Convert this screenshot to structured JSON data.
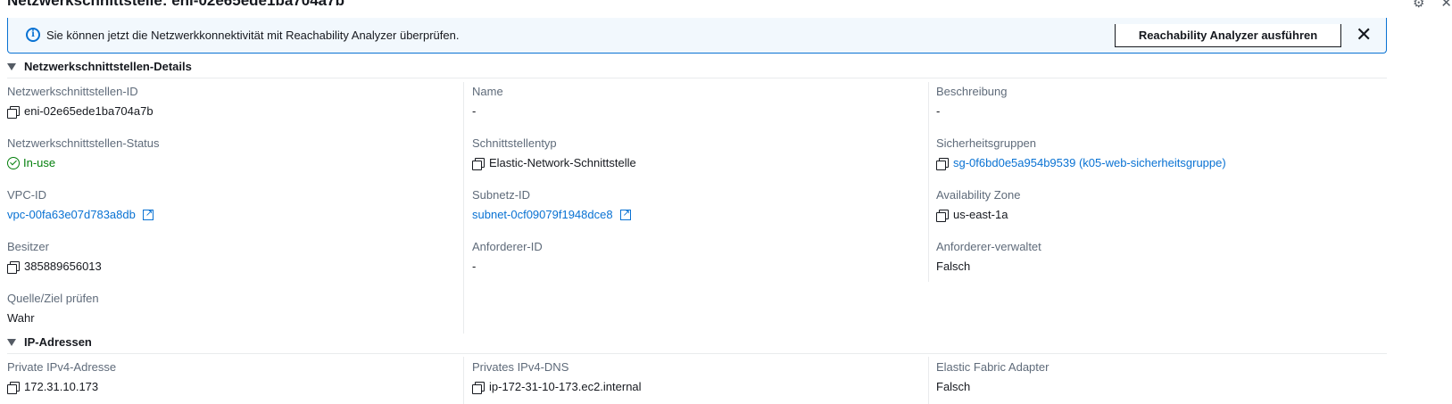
{
  "panel": {
    "title": "Netzwerkschnittstelle: eni-02e65ede1ba704a7b"
  },
  "banner": {
    "message": "Sie können jetzt die Netzwerkkonnektivität mit Reachability Analyzer überprüfen.",
    "button_label": "Reachability Analyzer ausführen"
  },
  "details": {
    "title": "Netzwerkschnittstellen-Details",
    "eni_id": {
      "label": "Netzwerkschnittstellen-ID",
      "value": "eni-02e65ede1ba704a7b"
    },
    "name": {
      "label": "Name",
      "value": "-"
    },
    "description": {
      "label": "Beschreibung",
      "value": "-"
    },
    "status": {
      "label": "Netzwerkschnittstellen-Status",
      "value": "In-use"
    },
    "interface_type": {
      "label": "Schnittstellentyp",
      "value": "Elastic-Network-Schnittstelle"
    },
    "security_groups": {
      "label": "Sicherheitsgruppen",
      "value": "sg-0f6bd0e5a954b9539 (k05-web-sicherheitsgruppe)"
    },
    "vpc_id": {
      "label": "VPC-ID",
      "value": "vpc-00fa63e07d783a8db"
    },
    "subnet_id": {
      "label": "Subnetz-ID",
      "value": "subnet-0cf09079f1948dce8"
    },
    "availability_zone": {
      "label": "Availability Zone",
      "value": "us-east-1a"
    },
    "owner": {
      "label": "Besitzer",
      "value": "385889656013"
    },
    "requester_id": {
      "label": "Anforderer-ID",
      "value": "-"
    },
    "requester_managed": {
      "label": "Anforderer-verwaltet",
      "value": "Falsch"
    },
    "source_dest_check": {
      "label": "Quelle/Ziel prüfen",
      "value": "Wahr"
    }
  },
  "ip": {
    "title": "IP-Adressen",
    "private_ipv4": {
      "label": "Private IPv4-Adresse",
      "value": "172.31.10.173"
    },
    "private_dns": {
      "label": "Privates IPv4-DNS",
      "value": "ip-172-31-10-173.ec2.internal"
    },
    "efa": {
      "label": "Elastic Fabric Adapter",
      "value": "Falsch"
    }
  },
  "colors": {
    "accent": "#0972d3",
    "success": "#037f0c",
    "label": "#5f6b7a"
  }
}
